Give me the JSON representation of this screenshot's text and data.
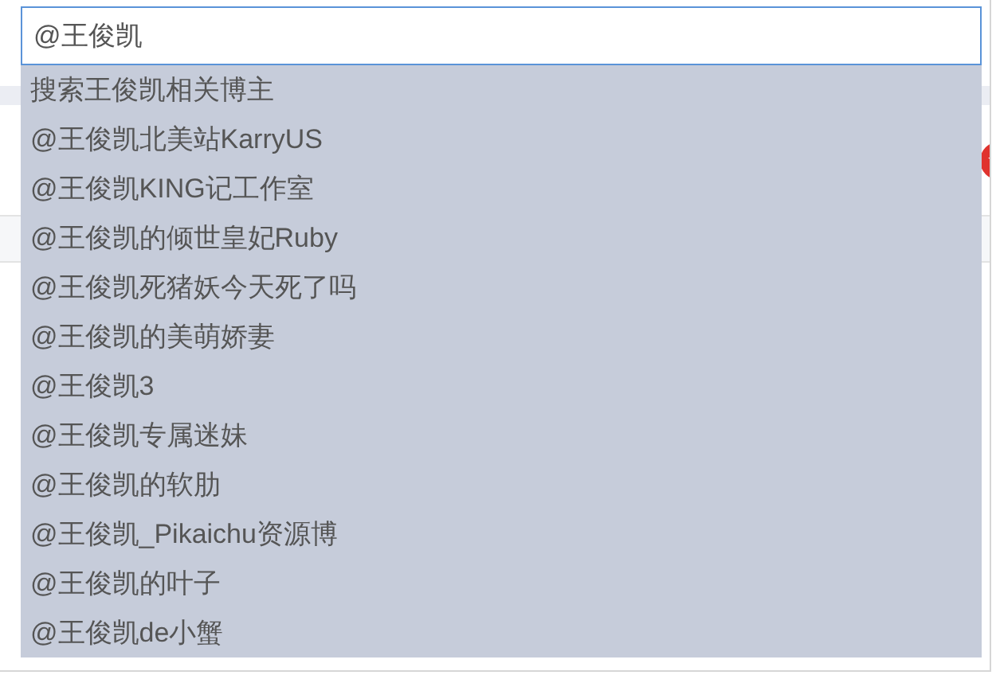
{
  "search": {
    "value": "@王俊凯"
  },
  "suggestions": [
    "搜索王俊凯相关博主",
    "@王俊凯北美站KarryUS",
    "@王俊凯KING记工作室",
    "@王俊凯的倾世皇妃Ruby",
    "@王俊凯死猪妖今天死了吗",
    "@王俊凯的美萌娇妻",
    "@王俊凯3",
    "@王俊凯专属迷妹",
    "@王俊凯的软肋",
    "@王俊凯_Pikaichu资源博",
    "@王俊凯的叶子",
    "@王俊凯de小蟹"
  ]
}
